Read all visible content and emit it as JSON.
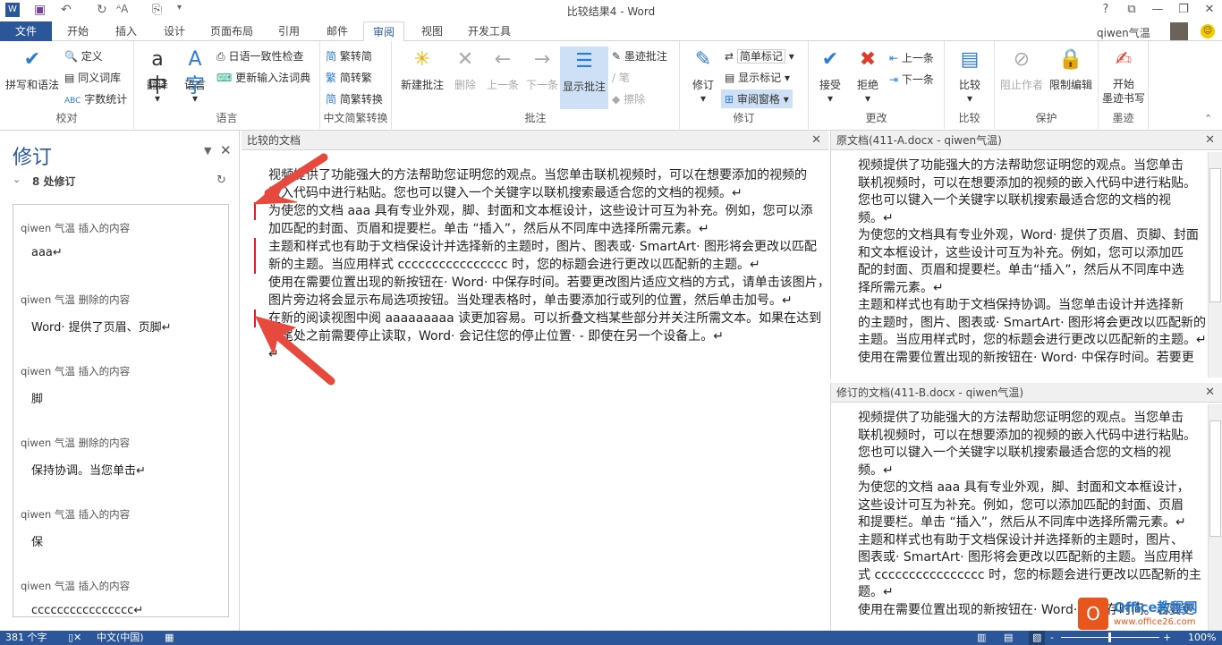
{
  "window": {
    "title": "比较结果4 - Word",
    "help": "?",
    "restore_ribbon": "⧉",
    "minimize": "—",
    "maximize": "❐",
    "close": "✕",
    "user": "qiwen气温"
  },
  "tabs": [
    "文件",
    "开始",
    "插入",
    "设计",
    "页面布局",
    "引用",
    "邮件",
    "审阅",
    "视图",
    "开发工具"
  ],
  "ribbon": {
    "proofing": {
      "label": "校对",
      "spell": "拼写和语法",
      "define": "定义",
      "thesaurus": "同义词库",
      "wordcount": "字数统计"
    },
    "language": {
      "label": "语言",
      "translate": "翻译",
      "language": "语言",
      "jp_check": "日语一致性检查",
      "ime_update": "更新输入法词典"
    },
    "chinese": {
      "label": "中文简繁转换",
      "t2s": "繁转简",
      "s2t": "简转繁",
      "convert": "简繁转换"
    },
    "comments": {
      "label": "批注",
      "new": "新建批注",
      "delete": "删除",
      "prev": "上一条",
      "next": "下一条",
      "show": "显示批注",
      "ink": "墨迹批注",
      "pen": "笔",
      "erase": "擦除"
    },
    "tracking": {
      "label": "修订",
      "track": "修订",
      "markup": "简单标记",
      "show_markup": "显示标记",
      "pane": "审阅窗格"
    },
    "changes": {
      "label": "更改",
      "accept": "接受",
      "reject": "拒绝",
      "prev": "上一条",
      "next": "下一条"
    },
    "compare": {
      "label": "比较",
      "compare": "比较"
    },
    "protect": {
      "label": "保护",
      "block": "阻止作者",
      "restrict": "限制编辑"
    },
    "ink": {
      "label": "墨迹",
      "start1": "开始",
      "start2": "墨迹书写"
    }
  },
  "revisions_pane": {
    "title": "修订",
    "count": "8 处修订",
    "items": [
      {
        "header": "qiwen 气温  插入的内容",
        "content": "aaa↵"
      },
      {
        "header": "qiwen 气温  删除的内容",
        "content": "Word· 提供了页眉、页脚↵"
      },
      {
        "header": "qiwen 气温  插入的内容",
        "content": "脚"
      },
      {
        "header": "qiwen 气温  删除的内容",
        "content": "保持协调。当您单击↵"
      },
      {
        "header": "qiwen 气温  插入的内容",
        "content": "保"
      },
      {
        "header": "qiwen 气温  插入的内容",
        "content": "cccccccccccccccc↵"
      }
    ]
  },
  "compared": {
    "title": "比较的文档",
    "lines": [
      "视频提供了功能强大的方法帮助您证明您的观点。当您单击联机视频时，可以在想要添加的视频的",
      "嵌入代码中进行粘贴。您也可以键入一个关键字以联机搜索最适合您的文档的视频。↵",
      "为使您的文档 aaa 具有专业外观，脚、封面和文本框设计，这些设计可互为补充。例如，您可以添",
      "加匹配的封面、页眉和提要栏。单击 “插入”，然后从不同库中选择所需元素。↵",
      "主题和样式也有助于文档保设计并选择新的主题时，图片、图表或· SmartArt· 图形将会更改以匹配",
      "新的主题。当应用样式 cccccccccccccccc 时，您的标题会进行更改以匹配新的主题。↵",
      "使用在需要位置出现的新按钮在· Word· 中保存时间。若要更改图片适应文档的方式，请单击该图片，",
      "图片旁边将会显示布局选项按钮。当处理表格时，单击要添加行或列的位置，然后单击加号。↵",
      "在新的阅读视图中阅 aaaaaaaaa 读更加容易。可以折叠文档某些部分并关注所需文本。如果在达到",
      "结尾处之前需要停止读取，Word· 会记住您的停止位置· - 即使在另一个设备上。↵",
      "↵"
    ]
  },
  "original": {
    "title": "原文档(411-A.docx - qiwen气温)",
    "lines": [
      "视频提供了功能强大的方法帮助您证明您的观点。当您单击",
      "联机视频时，可以在想要添加的视频的嵌入代码中进行粘贴。",
      "您也可以键入一个关键字以联机搜索最适合您的文档的视",
      "频。↵",
      "为使您的文档具有专业外观，Word· 提供了页眉、页脚、封面",
      "和文本框设计，这些设计可互为补充。例如，您可以添加匹",
      "配的封面、页眉和提要栏。单击“插入”，然后从不同库中选",
      "择所需元素。↵",
      "主题和样式也有助于文档保持协调。当您单击设计并选择新",
      "的主题时，图片、图表或· SmartArt· 图形将会更改以匹配新的",
      "主题。当应用样式时，您的标题会进行更改以匹配新的主题。↵",
      "使用在需要位置出现的新按钮在· Word· 中保存时间。若要更"
    ]
  },
  "revised": {
    "title": "修订的文档(411-B.docx - qiwen气温)",
    "lines": [
      "视频提供了功能强大的方法帮助您证明您的观点。当您单击",
      "联机视频时，可以在想要添加的视频的嵌入代码中进行粘贴。",
      "您也可以键入一个关键字以联机搜索最适合您的文档的视",
      "频。↵",
      "为使您的文档 aaa 具有专业外观，脚、封面和文本框设计，",
      "这些设计可互为补充。例如，您可以添加匹配的封面、页眉",
      "和提要栏。单击 “插入”，然后从不同库中选择所需元素。↵",
      "主题和样式也有助于文档保设计并选择新的主题时，图片、",
      "图表或· SmartArt· 图形将会更改以匹配新的主题。当应用样",
      "式 cccccccccccccccc 时，您的标题会进行更改以匹配新的主",
      "题。↵",
      "使用在需要位置出现的新按钮在· Word· 中保存时间。若要更"
    ]
  },
  "status": {
    "words": "381 个字",
    "lang": "中文(中国)",
    "zoom": "100%"
  },
  "watermark": {
    "name": "Office教程网",
    "url": "www.office26.com"
  },
  "colors": {
    "accent": "#2b579a",
    "change_bar": "#e02020",
    "arrow": "#e8493f"
  }
}
